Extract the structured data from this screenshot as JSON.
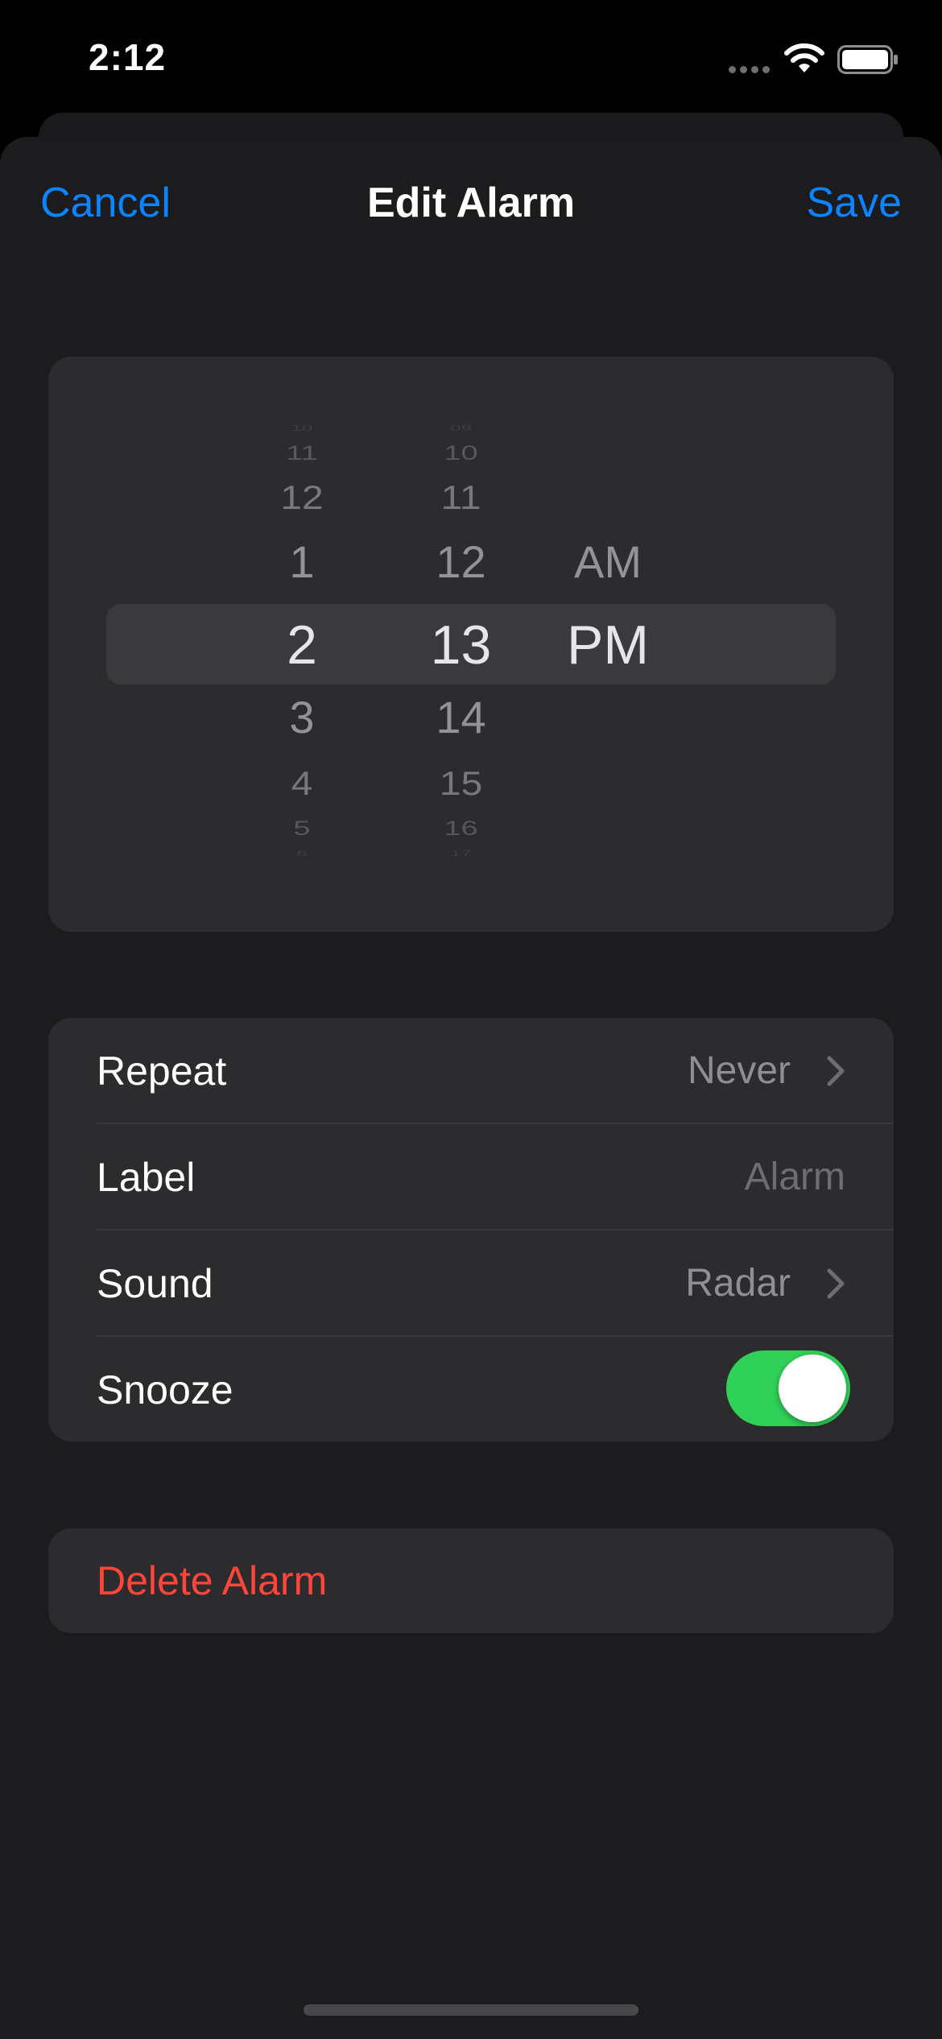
{
  "status_bar": {
    "time": "2:12",
    "icons": [
      "cellular-signal-icon",
      "wifi-icon",
      "battery-icon"
    ]
  },
  "nav": {
    "cancel_label": "Cancel",
    "title": "Edit Alarm",
    "save_label": "Save"
  },
  "picker": {
    "hours": [
      "10",
      "11",
      "12",
      "1",
      "2",
      "3",
      "4",
      "5",
      "6"
    ],
    "minutes": [
      "09",
      "10",
      "11",
      "12",
      "13",
      "14",
      "15",
      "16",
      "17"
    ],
    "periods": [
      "AM",
      "PM"
    ],
    "selected": {
      "hour": "2",
      "minute": "13",
      "period": "PM"
    }
  },
  "settings": {
    "repeat": {
      "label": "Repeat",
      "value": "Never",
      "icon": "chevron-right-icon"
    },
    "label_row": {
      "label": "Label",
      "placeholder": "Alarm"
    },
    "sound": {
      "label": "Sound",
      "value": "Radar",
      "icon": "chevron-right-icon"
    },
    "snooze": {
      "label": "Snooze",
      "on": true
    }
  },
  "delete": {
    "label": "Delete Alarm"
  },
  "colors": {
    "accent": "#0a84ff",
    "destructive": "#ff453a",
    "toggle_on": "#30d158",
    "background": "#1c1c1e",
    "card": "#2c2c2e"
  }
}
